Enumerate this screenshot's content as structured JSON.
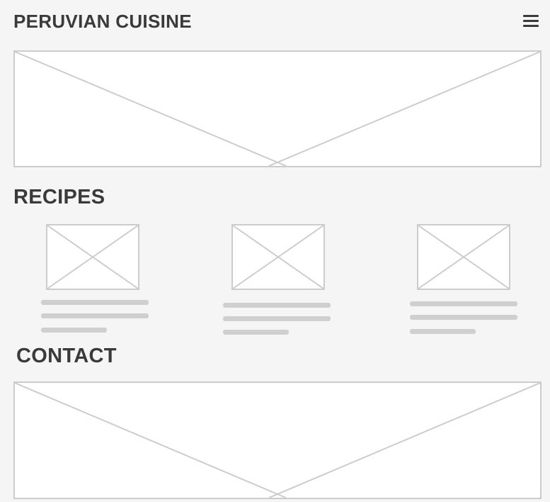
{
  "header": {
    "title": "PERUVIAN CUISINE",
    "menu_icon": "hamburger-icon"
  },
  "recipes": {
    "heading": "RECIPES",
    "cards": [
      {
        "image": "recipe-image-placeholder"
      },
      {
        "image": "recipe-image-placeholder"
      },
      {
        "image": "recipe-image-placeholder"
      }
    ]
  },
  "contact": {
    "heading": "CONTACT"
  },
  "colors": {
    "background": "#f5f5f5",
    "text": "#3a3a3a",
    "placeholder_stroke": "#cccccc",
    "text_line": "#cfcfcf"
  }
}
